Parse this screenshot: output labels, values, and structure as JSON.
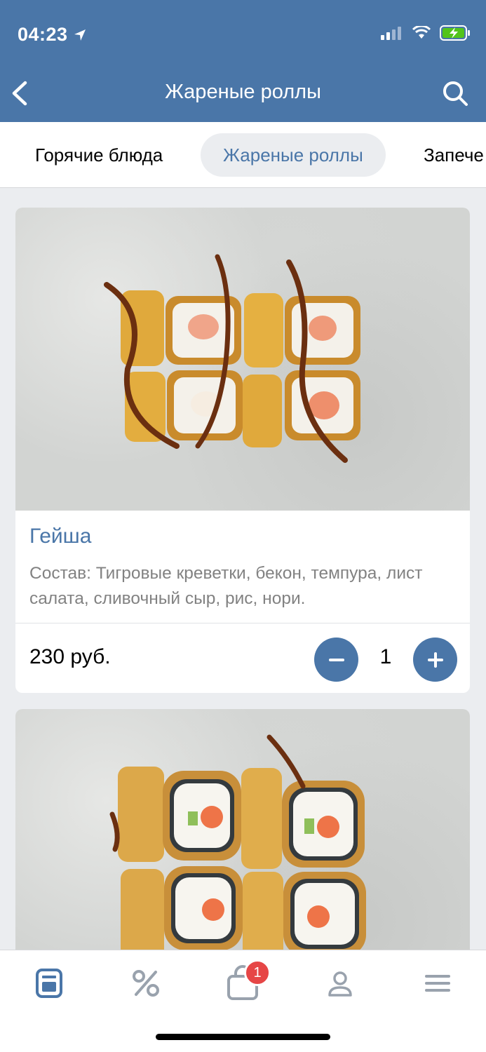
{
  "status_bar": {
    "time": "04:23"
  },
  "nav": {
    "title": "Жареные роллы",
    "back_icon": "chevron-left-icon",
    "search_icon": "search-icon"
  },
  "categories": [
    {
      "label": "Горячие блюда",
      "active": false
    },
    {
      "label": "Жареные роллы",
      "active": true
    },
    {
      "label": "Запече",
      "active": false
    }
  ],
  "products": [
    {
      "name": "Гейша",
      "description": "Состав: Тигровые креветки, бекон, темпура, лист салата, сливочный сыр, рис, нори.",
      "price": "230 руб.",
      "quantity": "1"
    }
  ],
  "tabbar": {
    "items": [
      "menu-icon",
      "percent-icon",
      "cart-icon",
      "profile-icon",
      "hamburger-icon"
    ],
    "cart_badge": "1"
  },
  "colors": {
    "accent": "#4a76a8",
    "background": "#ebedf0",
    "badge": "#e64646",
    "muted_text": "#828282"
  }
}
